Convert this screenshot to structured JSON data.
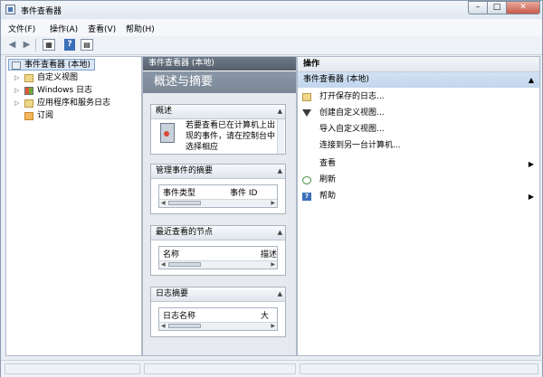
{
  "window": {
    "title": "事件查看器",
    "controls": {
      "minimize": "–",
      "maximize": "□",
      "close": "✕"
    }
  },
  "menu": {
    "file": "文件(F)",
    "action": "操作(A)",
    "view": "查看(V)",
    "help": "帮助(H)"
  },
  "toolbar": {
    "icons": [
      "back-arrow-icon",
      "forward-arrow-icon",
      "console-tree-icon",
      "help-icon",
      "show-pane-icon"
    ]
  },
  "tree": {
    "root": "事件查看器 (本地)",
    "items": [
      {
        "label": "自定义视图",
        "icon": "folder-icon"
      },
      {
        "label": "Windows 日志",
        "icon": "windows-log-icon"
      },
      {
        "label": "应用程序和服务日志",
        "icon": "folder-icon"
      },
      {
        "label": "订阅",
        "icon": "subscription-icon"
      }
    ]
  },
  "center": {
    "header": "事件查看器 (本地)",
    "title": "概述与摘要",
    "overview": {
      "heading": "概述",
      "text": "若要查看已在计算机上出现的事件，请在控制台中选择相应"
    },
    "summary": {
      "heading": "管理事件的摘要",
      "col1": "事件类型",
      "col2": "事件 ID"
    },
    "recent": {
      "heading": "最近查看的节点",
      "col1": "名称",
      "col2": "描述"
    },
    "log": {
      "heading": "日志摘要",
      "col1": "日志名称",
      "col2": "大"
    }
  },
  "actions": {
    "header": "操作",
    "section": "事件查看器 (本地)",
    "items": [
      {
        "label": "打开保存的日志...",
        "icon": "open-icon",
        "submenu": false
      },
      {
        "label": "创建自定义视图...",
        "icon": "filter-icon",
        "submenu": false
      },
      {
        "label": "导入自定义视图...",
        "icon": "",
        "submenu": false
      },
      {
        "label": "连接到另一台计算机...",
        "icon": "",
        "submenu": false
      },
      {
        "label": "查看",
        "icon": "",
        "submenu": true
      },
      {
        "label": "刷新",
        "icon": "refresh-icon",
        "submenu": false
      },
      {
        "label": "帮助",
        "icon": "help-icon",
        "submenu": true
      }
    ]
  },
  "colors": {
    "accent": "#3b6fb8",
    "selection": "#dbe7f6",
    "header_dark": "#55606d",
    "section_blue": "#c2d6ee"
  }
}
